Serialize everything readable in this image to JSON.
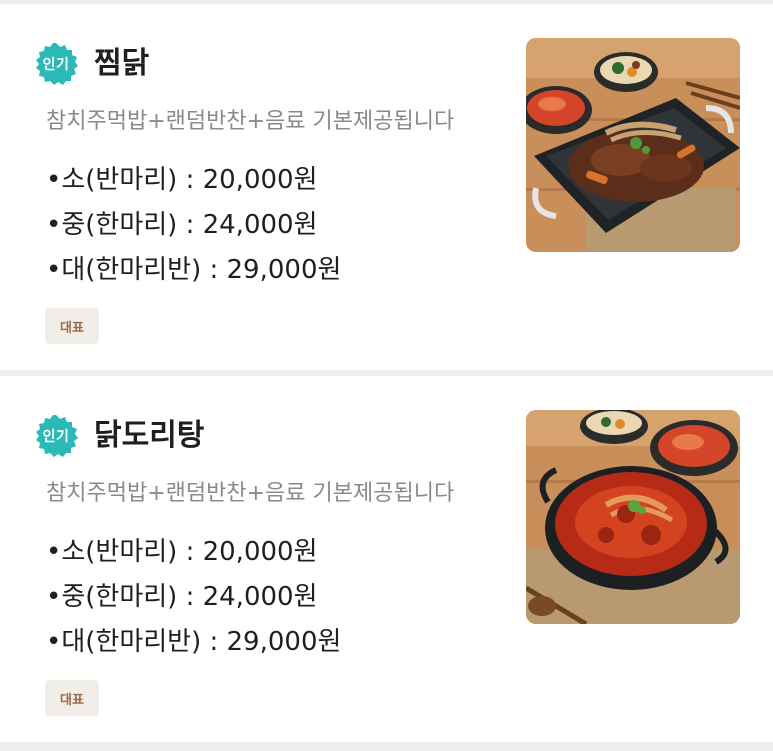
{
  "items": [
    {
      "popular_label": "인기",
      "name": "찜닭",
      "description": "참치주먹밥+랜덤반찬+음료 기본제공됩니다",
      "prices": [
        "•소(반마리) : 20,000원",
        "•중(한마리) : 24,000원",
        "•대(한마리반) : 29,000원"
      ],
      "tag": "대표",
      "image_icon": "jjimdak-photo"
    },
    {
      "popular_label": "인기",
      "name": "닭도리탕",
      "description": "참치주먹밥+랜덤반찬+음료 기본제공됩니다",
      "prices": [
        "•소(반마리) : 20,000원",
        "•중(한마리) : 24,000원",
        "•대(한마리반) : 29,000원"
      ],
      "tag": "대표",
      "image_icon": "dakdoritang-photo"
    }
  ],
  "colors": {
    "badge": "#2bb9b7",
    "tag_bg": "#f1ede8",
    "tag_text": "#9a6b45",
    "title": "#1f1f1f",
    "description": "#8a8a8a"
  }
}
